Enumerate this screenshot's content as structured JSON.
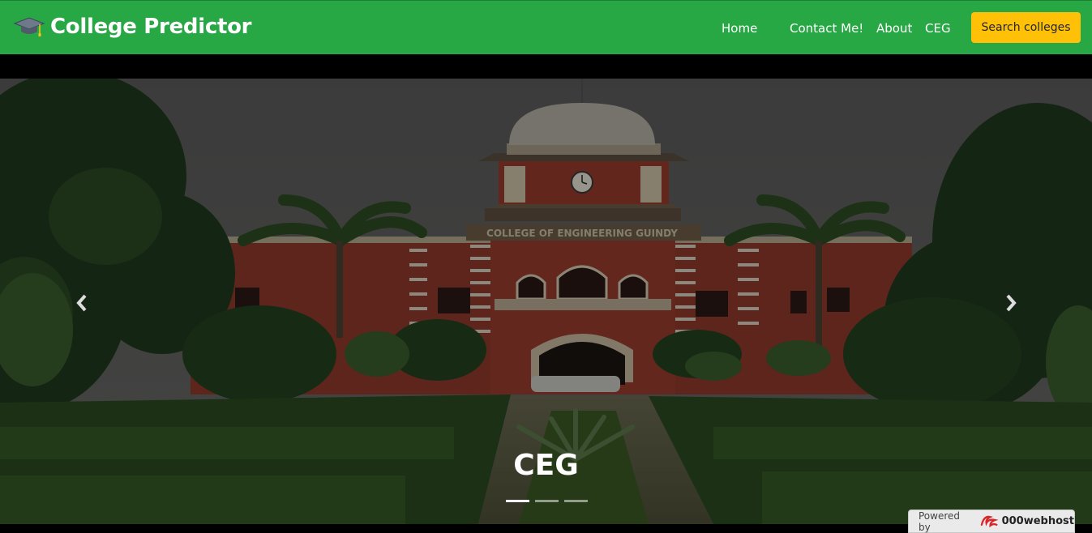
{
  "navbar": {
    "brand": "College Predictor",
    "brand_icon": "graduation-cap-icon",
    "background_color": "#28a745",
    "links": [
      {
        "label": "Home"
      },
      {
        "label": "Contact Me!"
      },
      {
        "label": "About"
      },
      {
        "label": "CEG"
      }
    ],
    "search_button": "Search colleges",
    "search_button_color": "#ffc107"
  },
  "carousel": {
    "image_sign_text": "COLLEGE OF ENGINEERING GUINDY",
    "caption": "CEG",
    "slides_count": 3,
    "active_slide": 1,
    "prev_icon": "chevron-left-icon",
    "next_icon": "chevron-right-icon"
  },
  "badge": {
    "prefix": "Powered by",
    "brand": "000webhost"
  }
}
